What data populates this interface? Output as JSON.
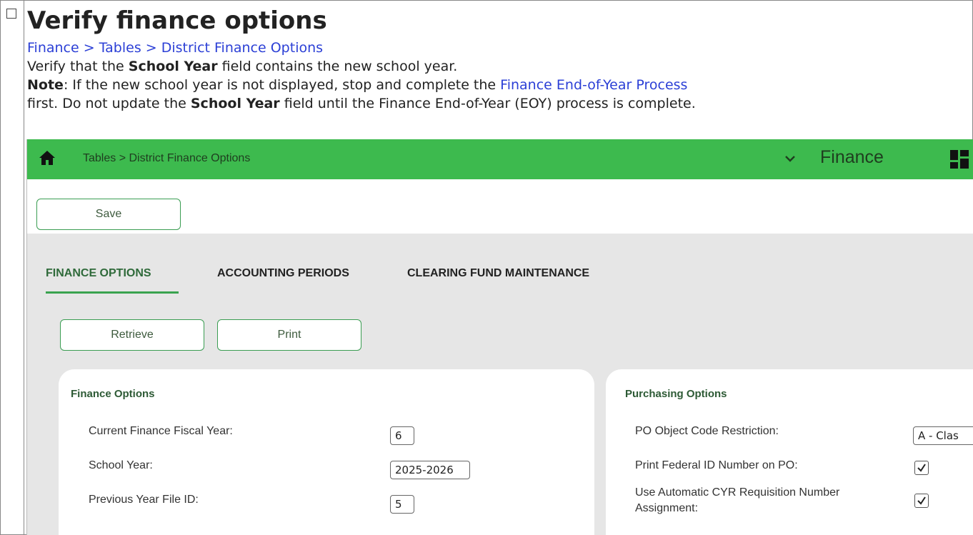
{
  "doc": {
    "title": "Verify finance options",
    "breadcrumb_link": "Finance > Tables > District Finance Options",
    "line1_pre": "Verify that the ",
    "line1_bold": "School Year",
    "line1_post": " field contains the new school year.",
    "note_label": "Note",
    "note_text": ": If the new school year is not displayed, stop and complete the ",
    "note_link": "Finance End-of-Year Process",
    "line3_pre": "first. Do not update the ",
    "line3_bold": "School Year",
    "line3_post": " field until the Finance End-of-Year (EOY) process is complete."
  },
  "app": {
    "breadcrumb": "Tables > District Finance Options",
    "module": "Finance",
    "save_label": "Save",
    "tabs": [
      {
        "label": "FINANCE OPTIONS",
        "active": true
      },
      {
        "label": "ACCOUNTING PERIODS",
        "active": false
      },
      {
        "label": "CLEARING FUND MAINTENANCE",
        "active": false
      }
    ],
    "retrieve_label": "Retrieve",
    "print_label": "Print",
    "finance_options": {
      "title": "Finance Options",
      "fields": [
        {
          "label": "Current Finance Fiscal Year:",
          "value": "6"
        },
        {
          "label": "School Year:",
          "value": "2025-2026"
        },
        {
          "label": "Previous Year File ID:",
          "value": "5"
        }
      ]
    },
    "purchasing_options": {
      "title": "Purchasing Options",
      "fields": [
        {
          "label": "PO Object Code Restriction:",
          "value": "A - Clas"
        },
        {
          "label": "Print Federal ID Number on PO:",
          "checked": true
        },
        {
          "label": "Use Automatic CYR Requisition Number",
          "label2": "Assignment:",
          "checked": true
        }
      ]
    },
    "colors": {
      "header": "#3dba4e",
      "accent": "#3a9d52",
      "content_bg": "#e6e6e6"
    }
  }
}
